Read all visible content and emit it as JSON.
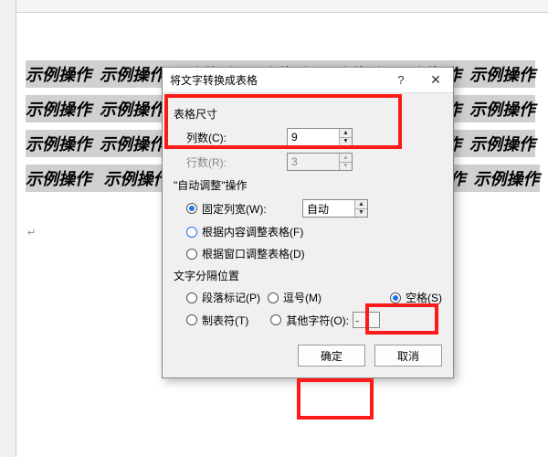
{
  "doc_sample_text": "示例操作",
  "cursor_mark": "↵",
  "dialog": {
    "title": "将文字转换成表格",
    "help": "?",
    "close": "✕",
    "size_group": "表格尺寸",
    "cols_label": "列数(C):",
    "cols_value": "9",
    "rows_label": "行数(R):",
    "rows_value": "3",
    "autofit_group": "\"自动调整\"操作",
    "fixed_width_label": "固定列宽(W):",
    "fixed_width_value": "自动",
    "fit_content_label": "根据内容调整表格(F)",
    "fit_window_label": "根据窗口调整表格(D)",
    "sep_group": "文字分隔位置",
    "sep_para": "段落标记(P)",
    "sep_comma": "逗号(M)",
    "sep_space": "空格(S)",
    "sep_tab": "制表符(T)",
    "sep_other": "其他字符(O):",
    "sep_other_value": "-",
    "ok": "确定",
    "cancel": "取消"
  }
}
